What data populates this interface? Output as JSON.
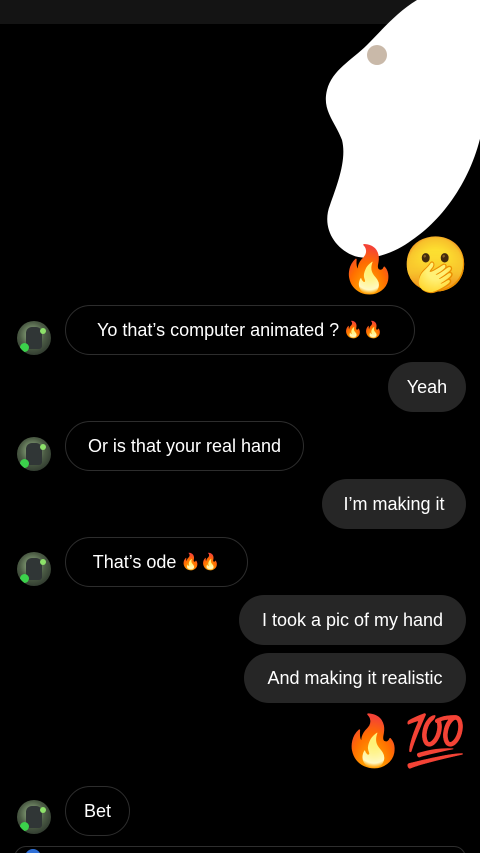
{
  "conversation": {
    "top_reactions": {
      "fire": "🔥",
      "hand_over_mouth": "🫢"
    },
    "messages": [
      {
        "from": "them",
        "text": "Yo that’s computer animated ?",
        "emoji": "🔥🔥"
      },
      {
        "from": "me",
        "text": "Yeah"
      },
      {
        "from": "them",
        "text": "Or is that your real hand"
      },
      {
        "from": "me",
        "text": "I’m making it"
      },
      {
        "from": "them",
        "text": "That’s ode",
        "emoji": "🔥🔥"
      },
      {
        "from": "me",
        "text": "I took a pic of my hand"
      },
      {
        "from": "me",
        "text": "And making it realistic"
      },
      {
        "from": "me",
        "emoji_fire": "🔥",
        "emoji_100": "💯"
      },
      {
        "from": "them",
        "text": "Bet"
      }
    ]
  },
  "colors": {
    "background": "#000000",
    "outgoing_bubble": "#262626",
    "incoming_border": "#2d2d2d",
    "text": "#ffffff",
    "redaction": "#ffffff"
  }
}
